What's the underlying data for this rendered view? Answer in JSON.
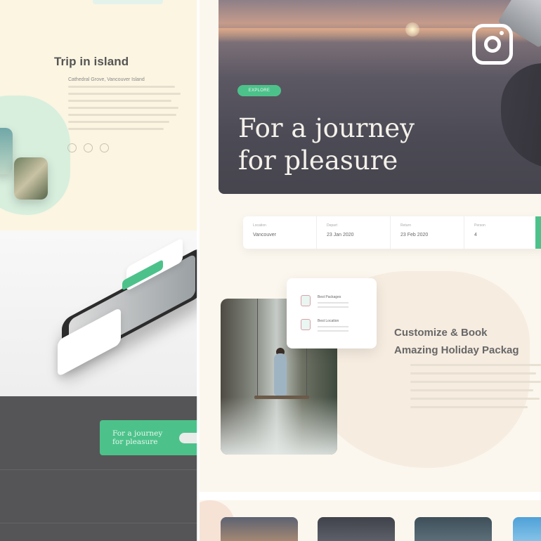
{
  "left": {
    "trip_title": "Trip in island",
    "trip_subtitle": "Cathedral Grove, Vancouver Island",
    "promo_text_line1": "For a journey",
    "promo_text_line2": "for pleasure"
  },
  "hero": {
    "badge": "EXPLORE",
    "title_line1": "For a journey",
    "title_line2": "for pleasure"
  },
  "search": {
    "fields": [
      {
        "label": "Location",
        "value": "Vancouver"
      },
      {
        "label": "Depart",
        "value": "23 Jan 2020"
      },
      {
        "label": "Return",
        "value": "23 Feb 2020"
      },
      {
        "label": "Person",
        "value": "4"
      }
    ]
  },
  "features": {
    "items": [
      {
        "label": "Best Packages"
      },
      {
        "label": "Best Location"
      }
    ]
  },
  "customize": {
    "heading_line1": "Customize & Book",
    "heading_line2": "Amazing Holiday Packag"
  },
  "icons": {
    "social": "instagram-icon"
  },
  "colors": {
    "accent": "#4cc28a",
    "dark_panel": "#555557",
    "cream": "#fbf7ee"
  }
}
